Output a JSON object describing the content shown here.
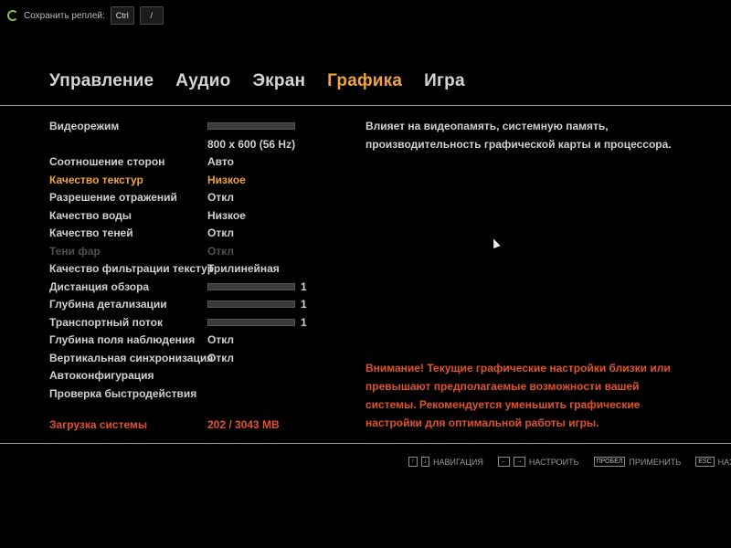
{
  "topbar": {
    "label": "Сохранить реплей:",
    "key1": "Ctrl",
    "key2": "/"
  },
  "tabs": [
    {
      "label": "Управление",
      "active": false
    },
    {
      "label": "Аудио",
      "active": false
    },
    {
      "label": "Экран",
      "active": false
    },
    {
      "label": "Графика",
      "active": true
    },
    {
      "label": "Игра",
      "active": false
    }
  ],
  "settings": [
    {
      "label": "Видеорежим",
      "value": "",
      "slider": true,
      "number": ""
    },
    {
      "label": "",
      "value": "800 x 600 (56 Hz)"
    },
    {
      "label": "Соотношение сторон",
      "value": "Авто"
    },
    {
      "label": "Качество текстур",
      "value": "Низкое",
      "state": "active"
    },
    {
      "label": "Разрешение отражений",
      "value": "Откл"
    },
    {
      "label": "Качество воды",
      "value": "Низкое"
    },
    {
      "label": "Качество теней",
      "value": "Откл"
    },
    {
      "label": "Тени фар",
      "value": "Откл",
      "state": "disabled"
    },
    {
      "label": "Качество фильтрации текстур",
      "value": "Трилинейная"
    },
    {
      "label": "Дистанция обзора",
      "slider": true,
      "number": "1"
    },
    {
      "label": "Глубина детализации",
      "slider": true,
      "number": "1"
    },
    {
      "label": "Транспортный поток",
      "slider": true,
      "number": "1"
    },
    {
      "label": "Глубина поля наблюдения",
      "value": "Откл"
    },
    {
      "label": "Вертикальная синхронизация",
      "value": "Откл"
    },
    {
      "label": "Автоконфигурация",
      "value": ""
    },
    {
      "label": "Проверка быстродействия",
      "value": ""
    }
  ],
  "system": {
    "label": "Загрузка системы",
    "value": "202 / 3043 MB"
  },
  "description": "Влияет на видеопамять, системную память, производительность графической карты и процессора.",
  "warning": "Внимание! Текущие графические настройки близки или превышают предполагаемые возможности вашей системы. Рекомендуется уменьшить графические настройки для оптимальной работы игры.",
  "footer": {
    "nav_label": "НАВИГАЦИЯ",
    "adjust_label": "НАСТРОИТЬ",
    "apply_key": "ПРОБЕЛ",
    "apply_label": "ПРИМЕНИТЬ",
    "back_key": "ESC",
    "back_label": "НАЗАД"
  }
}
